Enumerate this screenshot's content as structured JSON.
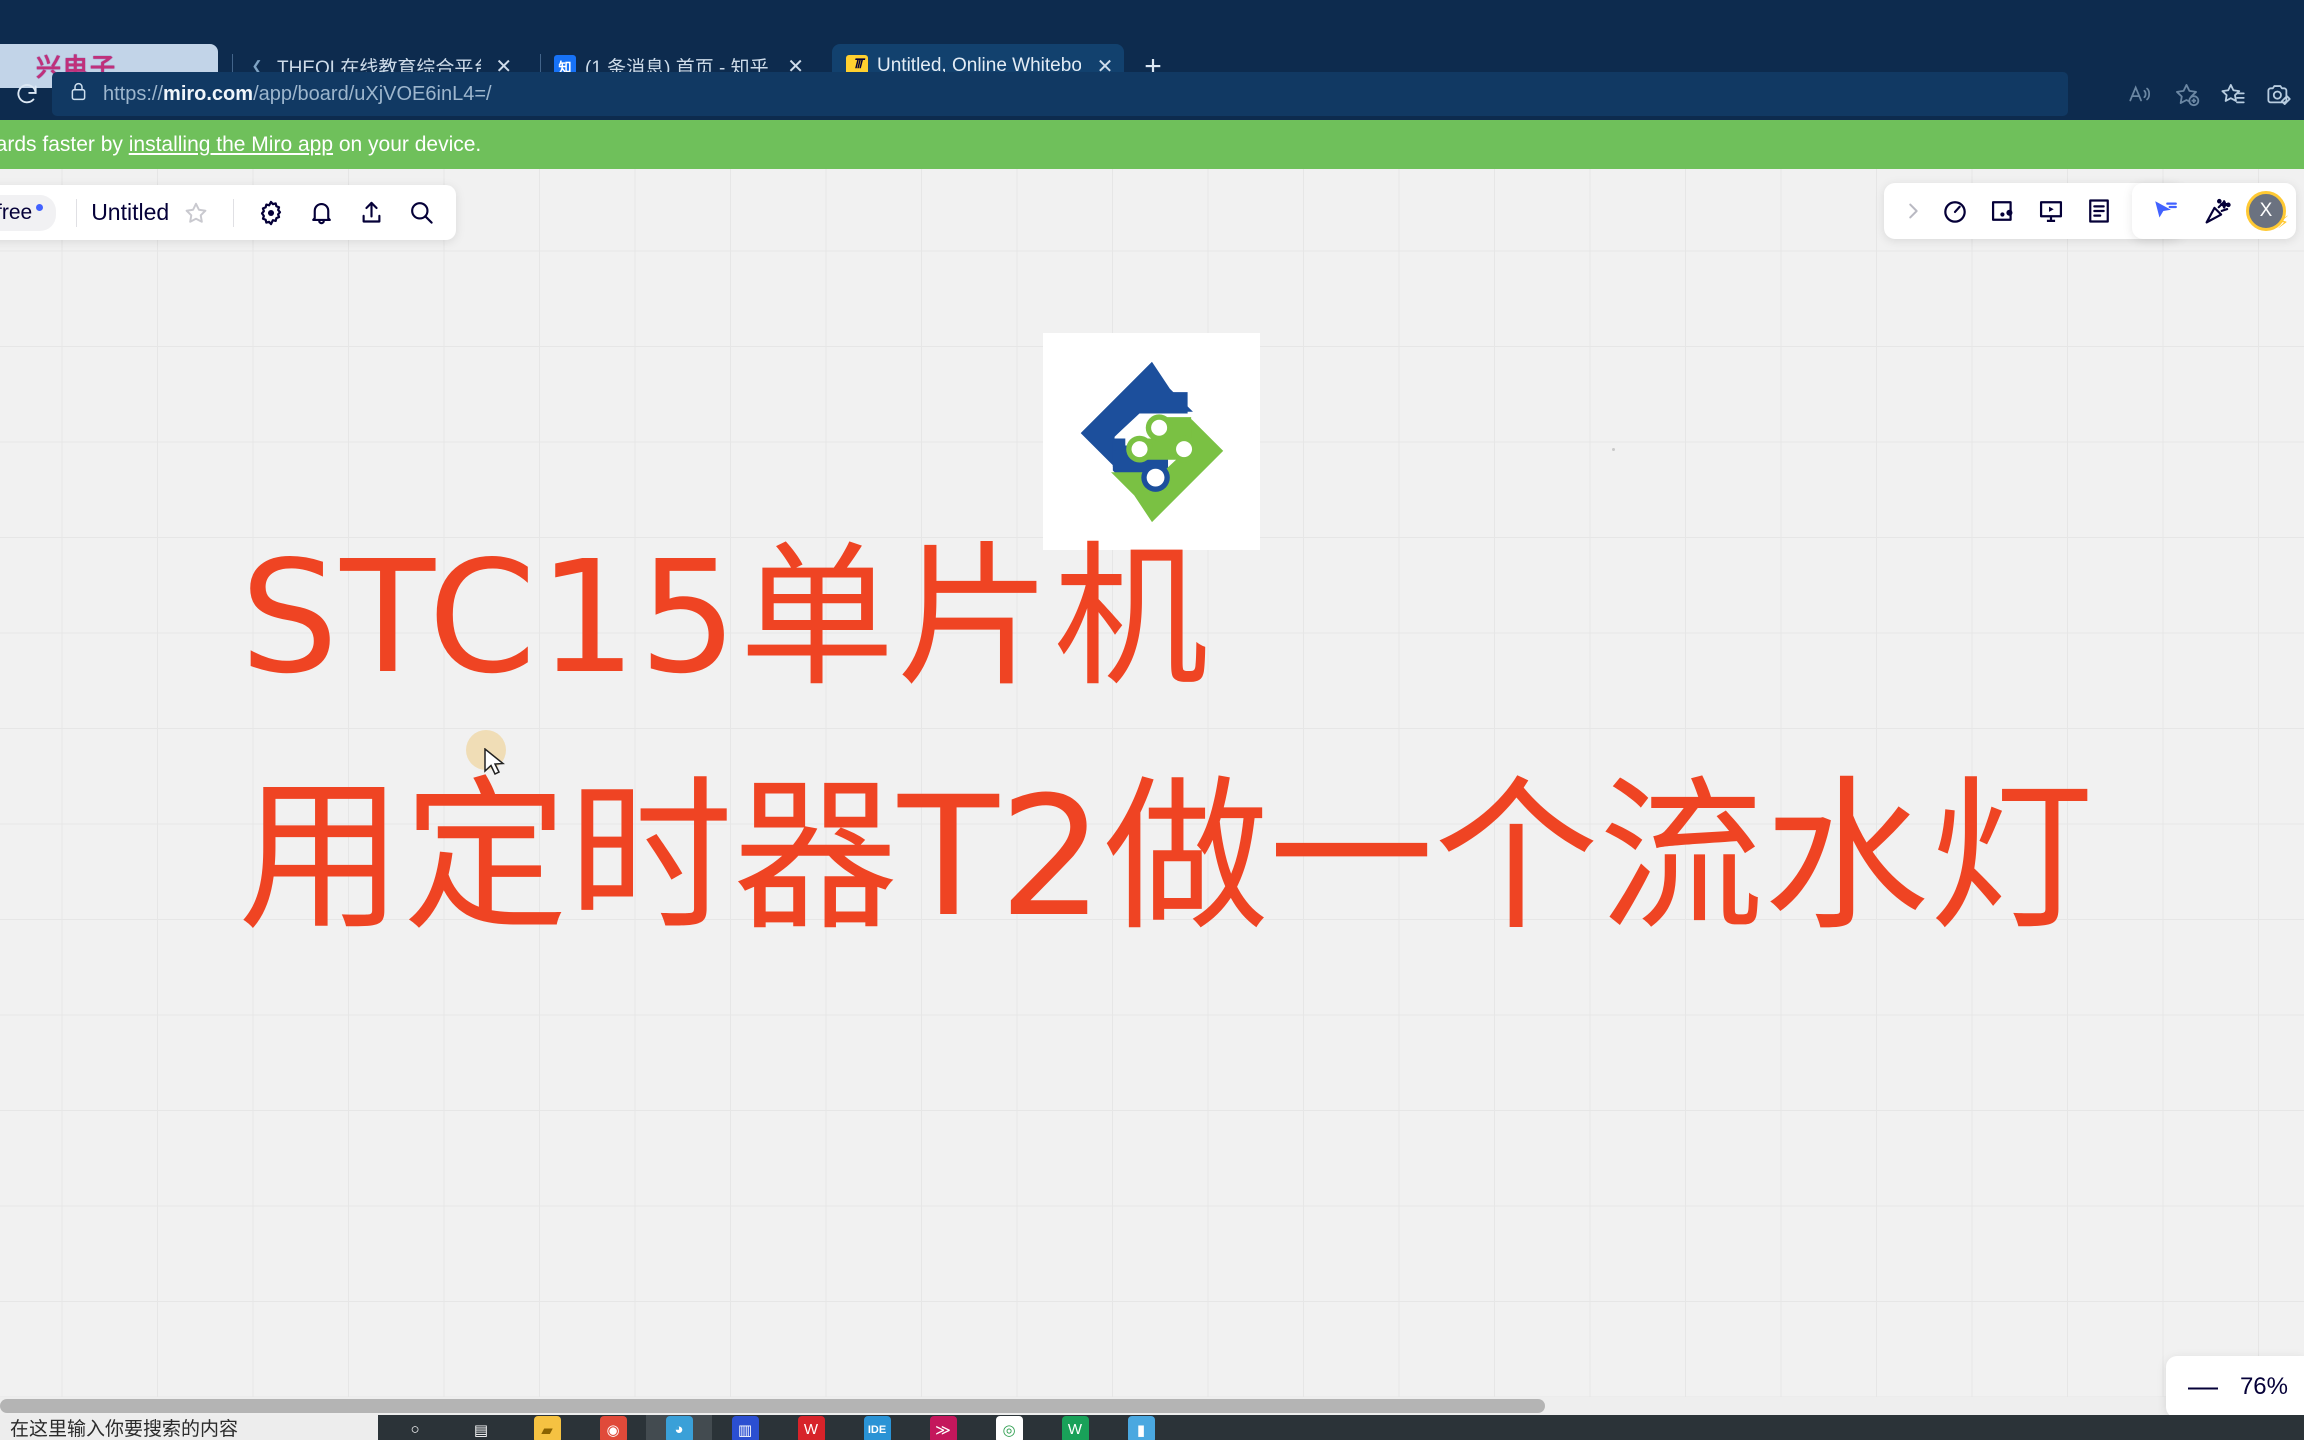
{
  "browser": {
    "pinned_tab": {
      "logo_text": "兴电子"
    },
    "tabs": [
      {
        "title": "THEOL在线教育综合平台-辽宁建",
        "favicon": "chevron-favicon",
        "favicon_text": "",
        "active": false
      },
      {
        "title": "(1 条消息) 首页 - 知乎",
        "favicon": "zhihu-favicon",
        "favicon_text": "知",
        "active": false
      },
      {
        "title": "Untitled, Online Whiteboard for",
        "favicon": "miro-favicon",
        "favicon_text": "m",
        "active": true
      }
    ],
    "new_tab_label": "+",
    "close_label": "✕",
    "reload_icon": "reload-icon",
    "lock_icon": "lock-icon",
    "url_scheme": "https://",
    "url_domain": "miro.com",
    "url_path": "/app/board/uXjVOE6inL4=/",
    "address_icons": [
      {
        "name": "read-aloud-icon",
        "glyph": "A"
      },
      {
        "name": "add-favorite-icon",
        "glyph": "☆"
      },
      {
        "name": "favorites-icon",
        "glyph": "☆"
      },
      {
        "name": "collections-icon",
        "glyph": "◎"
      }
    ]
  },
  "banner": {
    "text_before": "oards faster by ",
    "link_text": "installing the Miro app",
    "text_after": " on your device.",
    "bg_color": "#6fc05b"
  },
  "miro": {
    "plan_label": "free",
    "board_title": "Untitled",
    "left_icons": [
      {
        "name": "favorite-star-icon",
        "glyph": "☆"
      },
      {
        "name": "settings-gear-icon",
        "glyph": "gear"
      },
      {
        "name": "notifications-bell-icon",
        "glyph": "bell"
      },
      {
        "name": "share-upload-icon",
        "glyph": "upload"
      },
      {
        "name": "search-icon",
        "glyph": "search"
      }
    ],
    "right_icons": [
      {
        "name": "expand-chevron-icon",
        "glyph": "›"
      },
      {
        "name": "timer-icon",
        "glyph": "timer"
      },
      {
        "name": "screenshot-frame-icon",
        "glyph": "frame"
      },
      {
        "name": "presentation-icon",
        "glyph": "present"
      },
      {
        "name": "notes-icon",
        "glyph": "notes"
      },
      {
        "name": "more-chevrons-icon",
        "glyph": "more"
      }
    ],
    "user_icons": [
      {
        "name": "cursor-share-icon",
        "glyph": "cursor"
      },
      {
        "name": "confetti-icon",
        "glyph": "confetti"
      }
    ],
    "avatar_initial": "X",
    "zoom": {
      "minus_label": "—",
      "value": "76%"
    }
  },
  "board": {
    "logo_name": "circuit-diamond-logo",
    "logo_colors": {
      "blue": "#1c4f9c",
      "green": "#7ac143"
    },
    "title_color": "#ef4423",
    "line1": "STC15单片机",
    "line2": "用定时器T2做一个流水灯"
  },
  "taskbar": {
    "search_placeholder": "在这里输入你要搜索的内容",
    "items": [
      {
        "name": "cortana-icon",
        "glyph": "○",
        "color": "transparent",
        "text_color": "#ffffff",
        "highlight": false
      },
      {
        "name": "task-view-icon",
        "glyph": "▤",
        "color": "transparent",
        "text_color": "#ffffff",
        "highlight": false
      },
      {
        "name": "file-explorer-icon",
        "glyph": "▰",
        "color": "#f5c242",
        "text_color": "#8a6200",
        "highlight": false
      },
      {
        "name": "chrome-icon",
        "glyph": "◉",
        "color": "#e04a3a",
        "text_color": "#ffffff",
        "highlight": false
      },
      {
        "name": "edge-icon",
        "glyph": "◕",
        "color": "#3aa0d8",
        "text_color": "#ffffff",
        "highlight": true
      },
      {
        "name": "app-blue-icon",
        "glyph": "▥",
        "color": "#2b4fd1",
        "text_color": "#ffffff",
        "highlight": false
      },
      {
        "name": "app-red-icon",
        "glyph": "W",
        "color": "#d7232a",
        "text_color": "#ffffff",
        "highlight": false
      },
      {
        "name": "ide-icon",
        "glyph": "IDE",
        "color": "#2a93d5",
        "text_color": "#ffffff",
        "highlight": false
      },
      {
        "name": "app-pink-icon",
        "glyph": "≫",
        "color": "#c4175c",
        "text_color": "#ffffff",
        "highlight": false
      },
      {
        "name": "app-white-icon",
        "glyph": "◎",
        "color": "#ffffff",
        "text_color": "#2e9e4f",
        "highlight": false
      },
      {
        "name": "app-green-icon",
        "glyph": "W",
        "color": "#19a159",
        "text_color": "#ffffff",
        "highlight": false
      },
      {
        "name": "app-lightblue-icon",
        "glyph": "▮",
        "color": "#4aa8e0",
        "text_color": "#ffffff",
        "highlight": false
      }
    ]
  }
}
